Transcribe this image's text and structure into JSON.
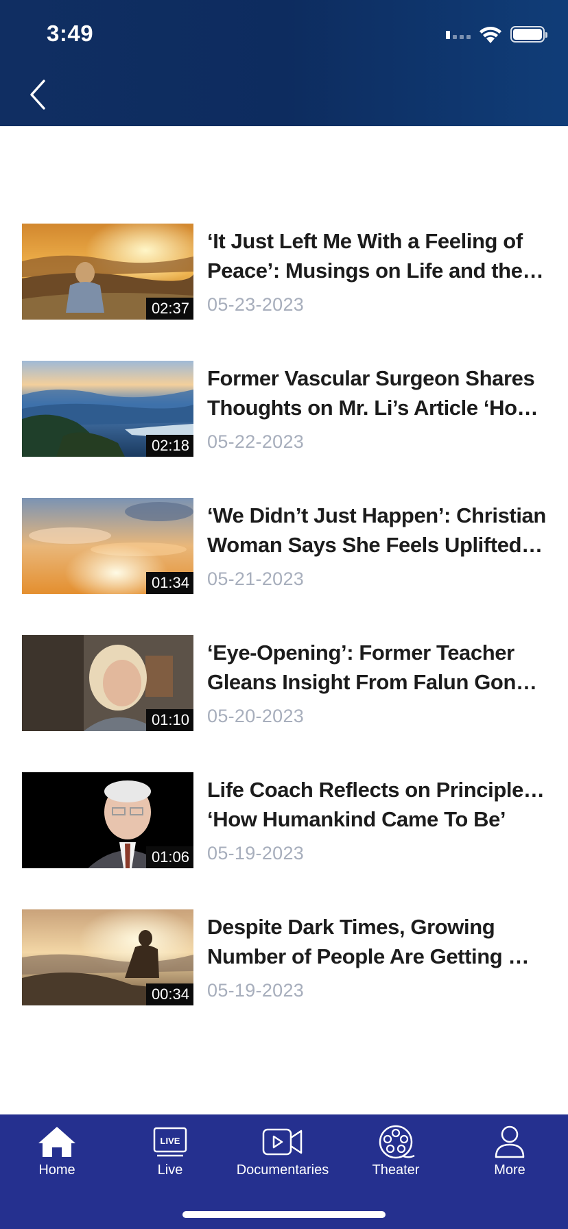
{
  "status_bar": {
    "time": "3:49"
  },
  "header": {
    "back_icon": "chevron-left-icon"
  },
  "videos": [
    {
      "title_line1": "‘It Just Left Me With a Feeling of",
      "title_line2": "Peace’: Musings on Life and the Afterlife",
      "date": "05-23-2023",
      "duration": "02:37"
    },
    {
      "title_line1": "Former Vascular Surgeon Shares",
      "title_line2": "Thoughts on Mr. Li’s Article ‘How Humankind Came To Be’",
      "date": "05-22-2023",
      "duration": "02:18"
    },
    {
      "title_line1": "‘We Didn’t Just Happen’: Christian",
      "title_line2": "Woman Says She Feels Uplifted After Reading",
      "date": "05-21-2023",
      "duration": "01:34"
    },
    {
      "title_line1": "‘Eye-Opening’: Former Teacher",
      "title_line2": "Gleans Insight From Falun Gong Founder",
      "date": "05-20-2023",
      "duration": "01:10"
    },
    {
      "title_line1": "Life Coach Reflects on Principles in",
      "title_line2": "‘How Humankind Came To Be’",
      "date": "05-19-2023",
      "duration": "01:06"
    },
    {
      "title_line1": "Despite Dark Times, Growing",
      "title_line2": "Number of People Are Getting Wiser",
      "date": "05-19-2023",
      "duration": "00:34"
    }
  ],
  "tabs": [
    {
      "label": "Home",
      "icon": "home-icon"
    },
    {
      "label": "Live",
      "icon": "live-tv-icon",
      "badge": "LIVE"
    },
    {
      "label": "Documentaries",
      "icon": "video-camera-icon"
    },
    {
      "label": "Theater",
      "icon": "film-reel-icon"
    },
    {
      "label": "More",
      "icon": "user-icon"
    }
  ],
  "colors": {
    "header": "#0d2c5f",
    "tabbar": "#25308f",
    "date": "#a7aebc"
  }
}
